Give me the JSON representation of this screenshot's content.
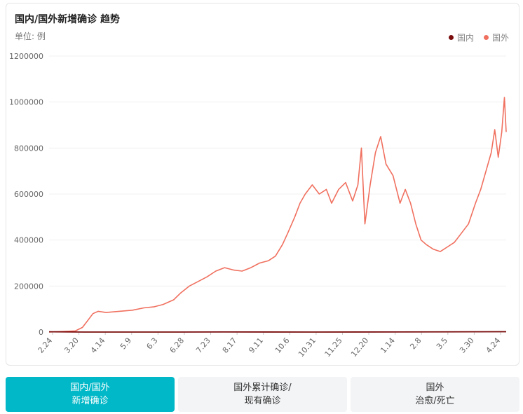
{
  "chart_title": "国内/国外新增确诊 趋势",
  "unit_label": "单位: 例",
  "legend": [
    {
      "name": "国内",
      "color": "#7a0c0c"
    },
    {
      "name": "国外",
      "color": "#f0705f"
    }
  ],
  "tabs": [
    {
      "line1": "国内/国外",
      "line2": "新增确诊",
      "active": true
    },
    {
      "line1": "国外累计确诊/",
      "line2": "现有确诊",
      "active": false
    },
    {
      "line1": "国外",
      "line2": "治愈/死亡",
      "active": false
    }
  ],
  "chart_data": {
    "type": "line",
    "ylim": [
      0,
      1200000
    ],
    "yticks": [
      0,
      200000,
      400000,
      600000,
      800000,
      1000000,
      1200000
    ],
    "xticks": [
      "2.24",
      "3.20",
      "4.14",
      "5.9",
      "6.3",
      "6.28",
      "7.23",
      "8.17",
      "9.11",
      "10.6",
      "10.31",
      "11.25",
      "12.20",
      "1.14",
      "2.8",
      "3.5",
      "3.30",
      "4.24"
    ],
    "grid": true,
    "legend_position": "top-right",
    "series": [
      {
        "name": "国外",
        "color": "#f0705f",
        "values": [
          [
            0,
            0
          ],
          [
            30,
            5000
          ],
          [
            38,
            20000
          ],
          [
            44,
            50000
          ],
          [
            50,
            80000
          ],
          [
            56,
            90000
          ],
          [
            65,
            85000
          ],
          [
            80,
            90000
          ],
          [
            95,
            95000
          ],
          [
            108,
            105000
          ],
          [
            120,
            110000
          ],
          [
            130,
            120000
          ],
          [
            142,
            140000
          ],
          [
            150,
            170000
          ],
          [
            160,
            200000
          ],
          [
            170,
            220000
          ],
          [
            180,
            240000
          ],
          [
            190,
            265000
          ],
          [
            200,
            280000
          ],
          [
            210,
            270000
          ],
          [
            220,
            265000
          ],
          [
            230,
            280000
          ],
          [
            240,
            300000
          ],
          [
            250,
            310000
          ],
          [
            258,
            330000
          ],
          [
            266,
            380000
          ],
          [
            272,
            430000
          ],
          [
            280,
            500000
          ],
          [
            286,
            560000
          ],
          [
            292,
            600000
          ],
          [
            300,
            640000
          ],
          [
            308,
            600000
          ],
          [
            316,
            620000
          ],
          [
            322,
            560000
          ],
          [
            330,
            620000
          ],
          [
            338,
            650000
          ],
          [
            346,
            570000
          ],
          [
            352,
            640000
          ],
          [
            356,
            800000
          ],
          [
            360,
            470000
          ],
          [
            366,
            640000
          ],
          [
            372,
            780000
          ],
          [
            378,
            850000
          ],
          [
            384,
            730000
          ],
          [
            392,
            680000
          ],
          [
            400,
            560000
          ],
          [
            406,
            620000
          ],
          [
            412,
            560000
          ],
          [
            418,
            470000
          ],
          [
            424,
            400000
          ],
          [
            430,
            380000
          ],
          [
            438,
            360000
          ],
          [
            446,
            350000
          ],
          [
            454,
            370000
          ],
          [
            462,
            390000
          ],
          [
            470,
            430000
          ],
          [
            478,
            470000
          ],
          [
            486,
            560000
          ],
          [
            492,
            620000
          ],
          [
            498,
            700000
          ],
          [
            504,
            780000
          ],
          [
            508,
            880000
          ],
          [
            512,
            760000
          ],
          [
            516,
            870000
          ],
          [
            519,
            1020000
          ],
          [
            521,
            870000
          ]
        ]
      },
      {
        "name": "国内",
        "color": "#7a0c0c",
        "values": [
          [
            0,
            1200
          ],
          [
            25,
            200
          ],
          [
            40,
            150
          ],
          [
            80,
            100
          ],
          [
            120,
            80
          ],
          [
            200,
            200
          ],
          [
            300,
            100
          ],
          [
            400,
            300
          ],
          [
            521,
            1500
          ]
        ]
      }
    ]
  }
}
